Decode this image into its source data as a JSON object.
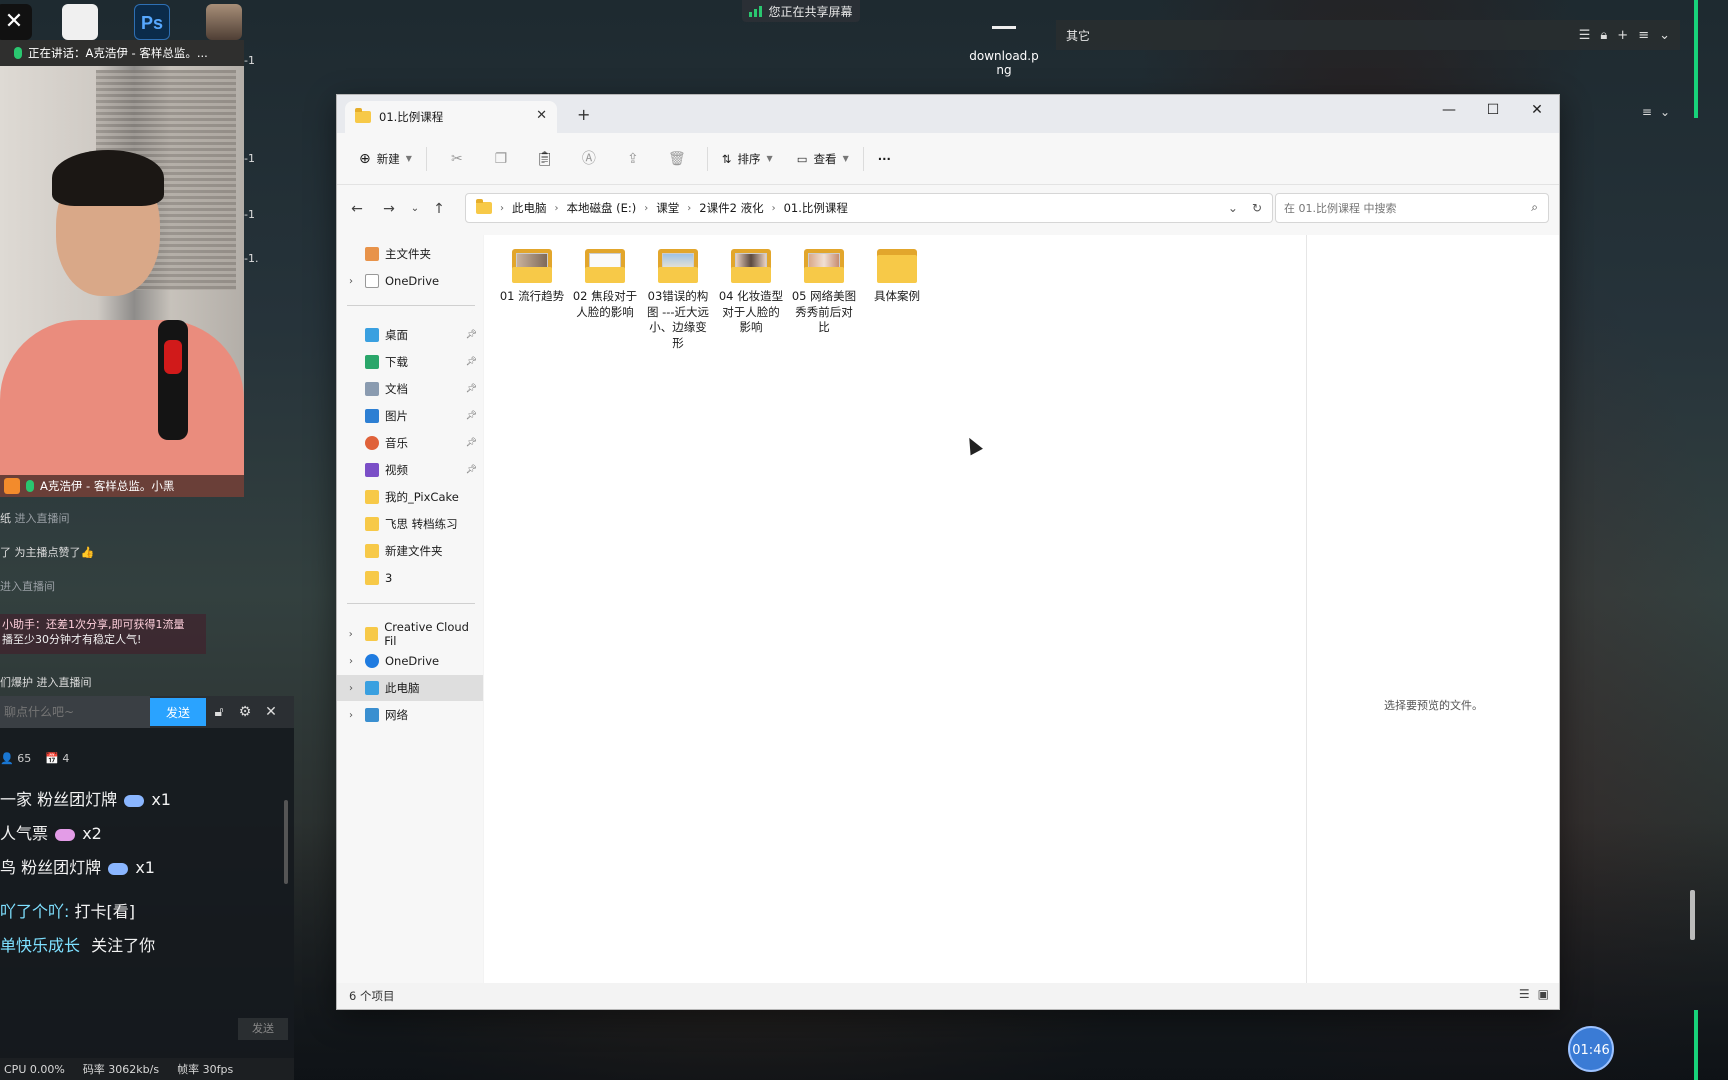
{
  "desktop": {
    "share_banner": "您正在共享屏幕",
    "download_file": "download.png",
    "top_bar_label": "其它",
    "timer": "01:46"
  },
  "cam": {
    "top_caption": "正在讲话：A克浩伊 - 客样总监。...",
    "name_caption": "A克浩伊 - 客样总监。小黑",
    "side_marks": [
      "-1",
      "-1",
      "-1",
      "-1."
    ]
  },
  "chat": {
    "lines": [
      {
        "user": "纸",
        "text": "进入直播间"
      },
      {
        "user": "了",
        "text": "为主播点赞了👍"
      },
      {
        "user": "",
        "text": "进入直播间"
      }
    ],
    "notice_line1": "小助手：还差1次分享,即可获得1流量",
    "notice_line2": "播至少30分钟才有稳定人气!",
    "line_after": "们爆护 进入直播间",
    "input_placeholder": "聊点什么吧~",
    "send_label": "发送",
    "stats_viewers": "65",
    "stats_gifts": "4",
    "gifts": [
      {
        "user": "一家",
        "gift": "粉丝团灯牌",
        "count": "x1"
      },
      {
        "user": "",
        "gift": "人气票",
        "count": "x2"
      },
      {
        "user": "鸟",
        "gift": "粉丝团灯牌",
        "count": "x1"
      }
    ],
    "msg_user": "吖了个吖:",
    "msg_text": "打卡[看]",
    "follow_user": "单快乐成长",
    "follow_text": "关注了你",
    "gift_send_label": "发送",
    "status_cpu": "CPU 0.00%",
    "status_bitrate": "码率 3062kb/s",
    "status_fps": "帧率 30fps"
  },
  "explorer": {
    "tab_title": "01.比例课程",
    "toolbar": {
      "new_label": "新建",
      "sort_label": "排序",
      "view_label": "查看",
      "more_label": "···"
    },
    "breadcrumb": [
      "此电脑",
      "本地磁盘 (E:)",
      "课堂",
      "2课件2  液化",
      "01.比例课程"
    ],
    "search_placeholder": "在 01.比例课程 中搜索",
    "sidebar": {
      "home": "主文件夹",
      "onedrive_top": "OneDrive",
      "pinned": [
        "桌面",
        "下载",
        "文档",
        "图片",
        "音乐",
        "视频"
      ],
      "folders": [
        "我的_PixCake",
        "飞思 转档练习",
        "新建文件夹",
        "3"
      ],
      "drives": [
        "Creative Cloud Fil",
        "OneDrive",
        "此电脑",
        "网络"
      ]
    },
    "items": [
      {
        "name": "01 流行趋势",
        "thumb": "photo"
      },
      {
        "name": "02 焦段对于人脸的影响",
        "thumb": "doc"
      },
      {
        "name": "03错误的构图 ---近大远小、边缘变形",
        "thumb": "sky"
      },
      {
        "name": "04 化妆造型对于人脸的影响",
        "thumb": "photo"
      },
      {
        "name": "05 网络美图秀秀前后对比",
        "thumb": "photo2"
      },
      {
        "name": "具体案例",
        "thumb": "none"
      }
    ],
    "preview_text": "选择要预览的文件。",
    "status_count": "6 个项目"
  }
}
